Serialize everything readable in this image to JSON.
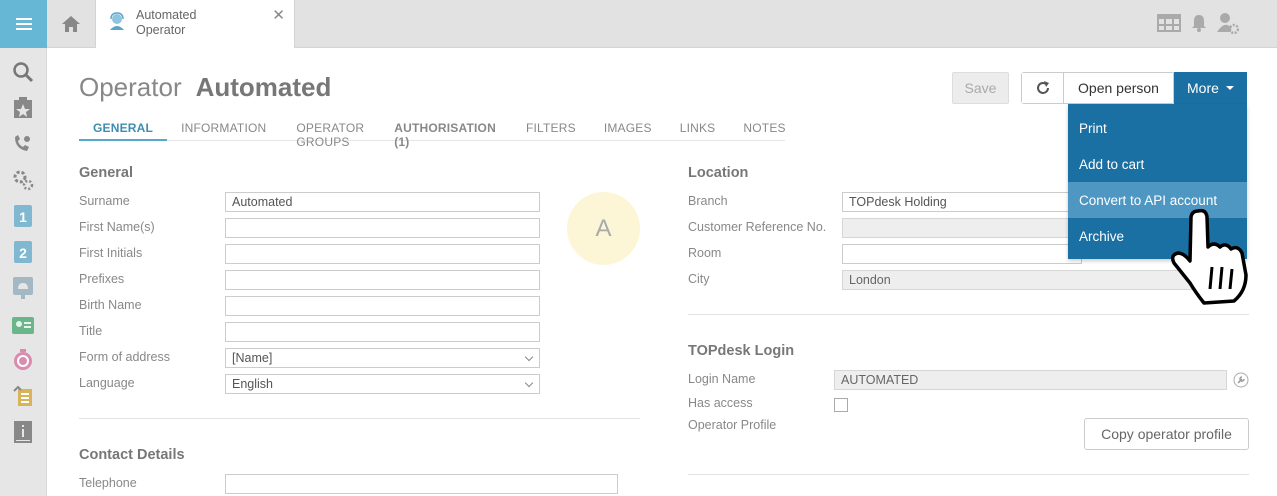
{
  "tab": {
    "title": "Automated Operator"
  },
  "page": {
    "title_type": "Operator",
    "title_name": "Automated"
  },
  "tabs": [
    {
      "label": "GENERAL"
    },
    {
      "label": "INFORMATION"
    },
    {
      "label": "OPERATOR GROUPS"
    },
    {
      "label": "AUTHORISATION (1)"
    },
    {
      "label": "FILTERS"
    },
    {
      "label": "IMAGES"
    },
    {
      "label": "LINKS"
    },
    {
      "label": "NOTES"
    }
  ],
  "toolbar": {
    "save": "Save",
    "open_person": "Open person",
    "more": "More"
  },
  "more_menu": [
    {
      "label": "Print"
    },
    {
      "label": "Add to cart"
    },
    {
      "label": "Convert to API account"
    },
    {
      "label": "Archive"
    }
  ],
  "general": {
    "heading": "General",
    "surname_label": "Surname",
    "surname": "Automated",
    "first_names_label": "First Name(s)",
    "first_names": "",
    "first_initials_label": "First Initials",
    "first_initials": "",
    "prefixes_label": "Prefixes",
    "prefixes": "",
    "birth_name_label": "Birth Name",
    "birth_name": "",
    "title_label": "Title",
    "title": "",
    "form_label": "Form of address",
    "form": "[Name]",
    "language_label": "Language",
    "language": "English"
  },
  "avatar": {
    "initial": "A"
  },
  "location": {
    "heading": "Location",
    "branch_label": "Branch",
    "branch": "TOPdesk Holding",
    "customer_ref_label": "Customer Reference No.",
    "customer_ref": "",
    "room_label": "Room",
    "room": "",
    "city_label": "City",
    "city": "London"
  },
  "login": {
    "heading": "TOPdesk Login",
    "login_name_label": "Login Name",
    "login_name": "AUTOMATED",
    "has_access_label": "Has access",
    "profile_label": "Operator Profile",
    "copy_profile": "Copy operator profile"
  },
  "contact": {
    "heading": "Contact Details",
    "telephone_label": "Telephone",
    "telephone": ""
  },
  "colors": {
    "sidebar_accent": "#66b6d6",
    "primary": "#1a6fa3",
    "highlight": "#4d97c2"
  }
}
